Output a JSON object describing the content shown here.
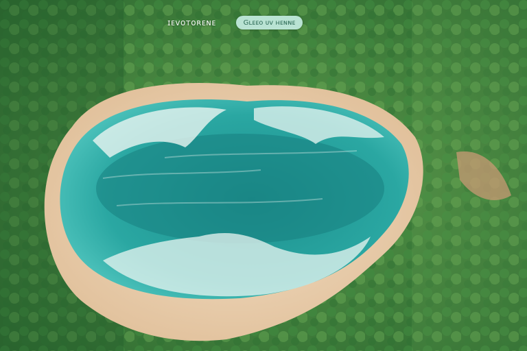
{
  "overlay": {
    "caption": "ɪᴇᴠᴏᴛᴏʀᴇɴᴇ",
    "pill_label": "Gʟᴇᴇᴏ ᴜᴠ ʜᴇɴɴᴇ"
  },
  "colors": {
    "forest_dark": "#2d6a30",
    "forest_light": "#5d9b4c",
    "sand": "#e9cfb0",
    "water_deep": "#1c8f8d",
    "water_light": "#4ec3bc",
    "surf": "#eaf5f1",
    "pill_bg": "#b9e3d3"
  }
}
